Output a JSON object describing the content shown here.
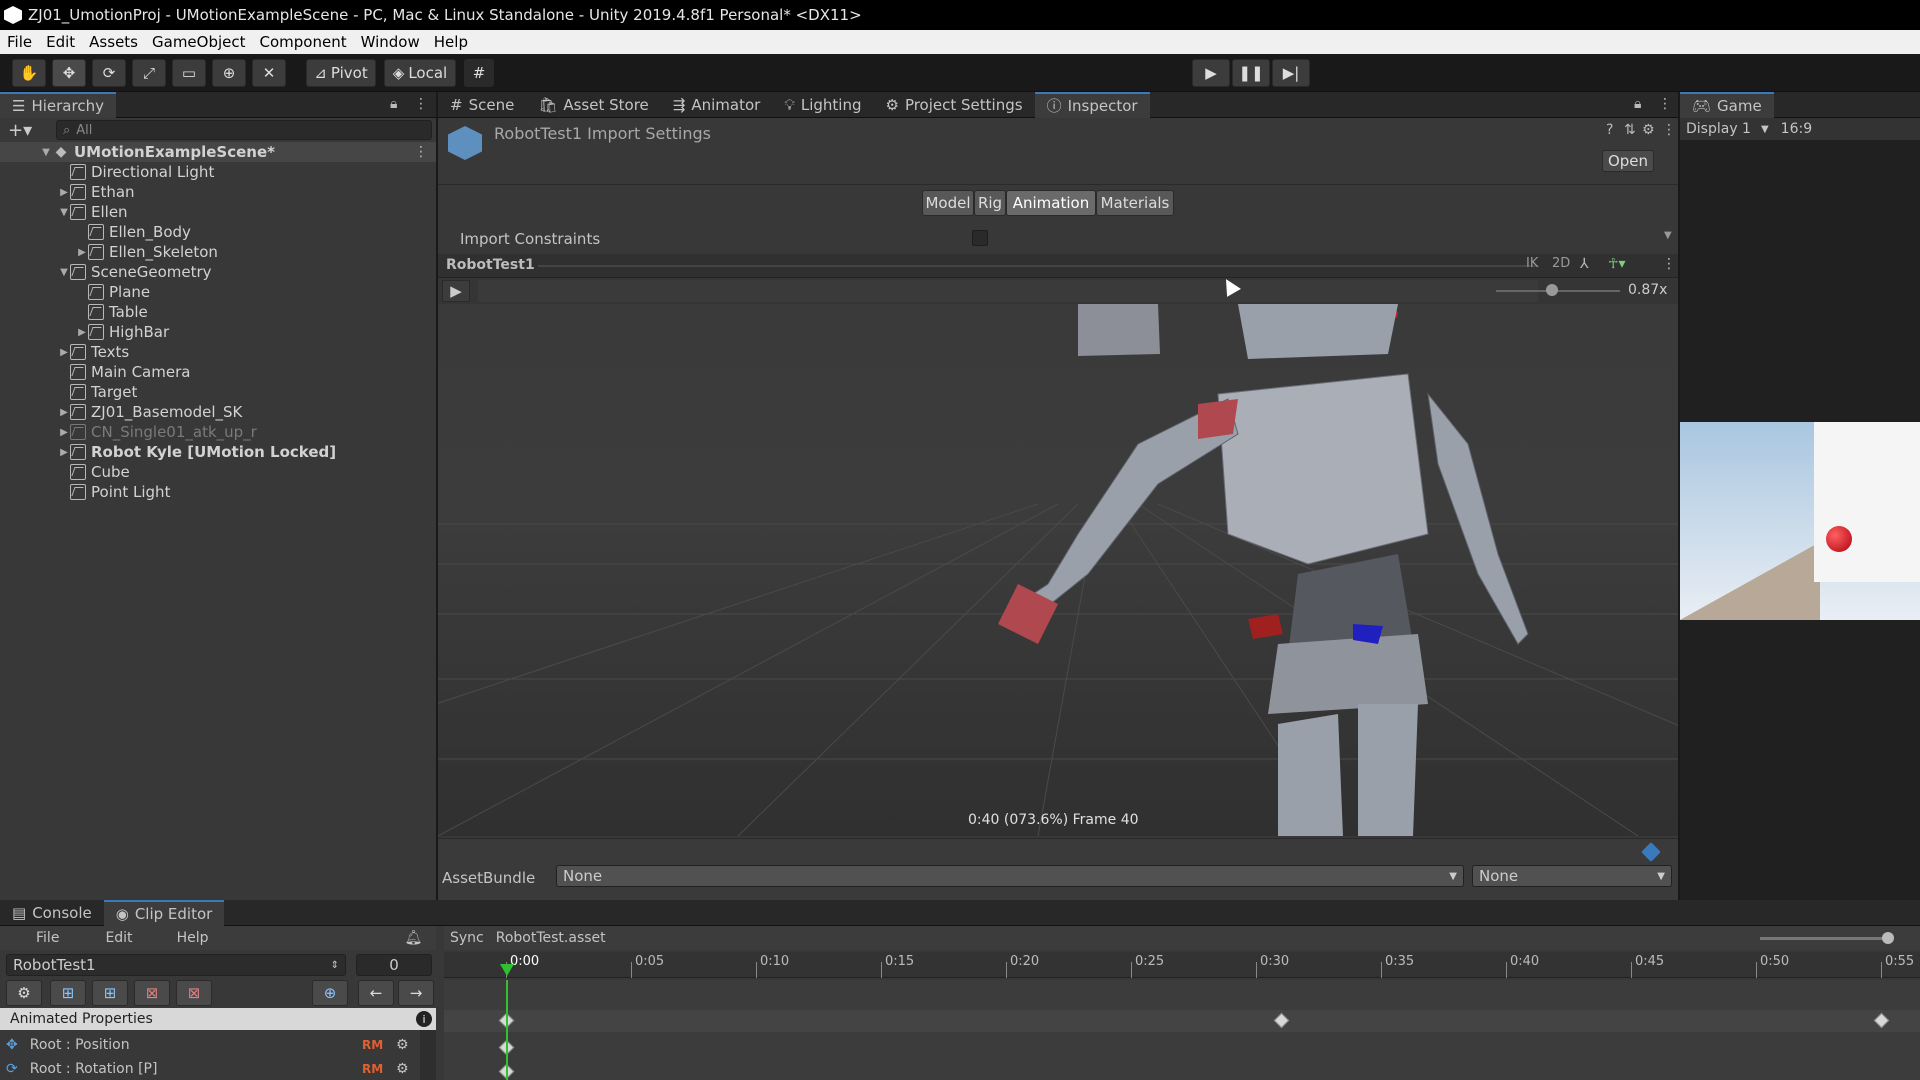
{
  "window": {
    "title": "ZJ01_UmotionProj - UMotionExampleScene - PC, Mac & Linux Standalone - Unity 2019.4.8f1 Personal* <DX11>"
  },
  "menu": [
    "File",
    "Edit",
    "Assets",
    "GameObject",
    "Component",
    "Window",
    "Help"
  ],
  "toolbar": {
    "pivot": "Pivot",
    "local": "Local"
  },
  "hierarchy": {
    "title": "Hierarchy",
    "search_placeholder": "All",
    "scene": "UMotionExampleScene*",
    "items": [
      {
        "label": "Directional Light",
        "depth": 1,
        "arrow": ""
      },
      {
        "label": "Ethan",
        "depth": 1,
        "arrow": "▶"
      },
      {
        "label": "Ellen",
        "depth": 1,
        "arrow": "▼"
      },
      {
        "label": "Ellen_Body",
        "depth": 2,
        "arrow": ""
      },
      {
        "label": "Ellen_Skeleton",
        "depth": 2,
        "arrow": "▶"
      },
      {
        "label": "SceneGeometry",
        "depth": 1,
        "arrow": "▼"
      },
      {
        "label": "Plane",
        "depth": 2,
        "arrow": ""
      },
      {
        "label": "Table",
        "depth": 2,
        "arrow": ""
      },
      {
        "label": "HighBar",
        "depth": 2,
        "arrow": "▶"
      },
      {
        "label": "Texts",
        "depth": 1,
        "arrow": "▶"
      },
      {
        "label": "Main Camera",
        "depth": 1,
        "arrow": ""
      },
      {
        "label": "Target",
        "depth": 1,
        "arrow": ""
      },
      {
        "label": "ZJ01_Basemodel_SK",
        "depth": 1,
        "arrow": "▶"
      },
      {
        "label": "CN_Single01_atk_up_r",
        "depth": 1,
        "arrow": "▶"
      },
      {
        "label": "Robot Kyle [UMotion Locked]",
        "depth": 1,
        "arrow": "▶"
      },
      {
        "label": "Cube",
        "depth": 1,
        "arrow": ""
      },
      {
        "label": "Point Light",
        "depth": 1,
        "arrow": ""
      }
    ]
  },
  "tabs": [
    "Scene",
    "Asset Store",
    "Animator",
    "Lighting",
    "Project Settings",
    "Inspector"
  ],
  "inspector": {
    "title": "RobotTest1 Import Settings",
    "open": "Open",
    "subtabs": [
      "Model",
      "Rig",
      "Animation",
      "Materials"
    ],
    "import_constraints": "Import Constraints",
    "clip_name": "RobotTest1",
    "ik": "IK",
    "two_d": "2D",
    "speed": "0.87x",
    "time_label": "0:40 (073.6%) Frame 40",
    "assetbundle_label": "AssetBundle",
    "assetbundle_value": "None",
    "assetbundle_variant": "None"
  },
  "game": {
    "title": "Game",
    "display": "Display 1",
    "aspect": "16:9"
  },
  "bottom": {
    "tabs": [
      "Console",
      "Clip Editor"
    ],
    "menu": [
      "File",
      "Edit",
      "Help"
    ],
    "clip_select": "RobotTest1",
    "frame": "0",
    "sync": "Sync",
    "asset": "RobotTest.asset",
    "animated_properties": "Animated Properties",
    "props": [
      {
        "label": "Root : Position",
        "badge": "RM"
      },
      {
        "label": "Root : Rotation [P]",
        "badge": "RM"
      }
    ],
    "ticks": [
      "0:00",
      "0:05",
      "0:10",
      "0:15",
      "0:20",
      "0:25",
      "0:30",
      "0:35",
      "0:40",
      "0:45",
      "0:50",
      "0:55"
    ]
  }
}
